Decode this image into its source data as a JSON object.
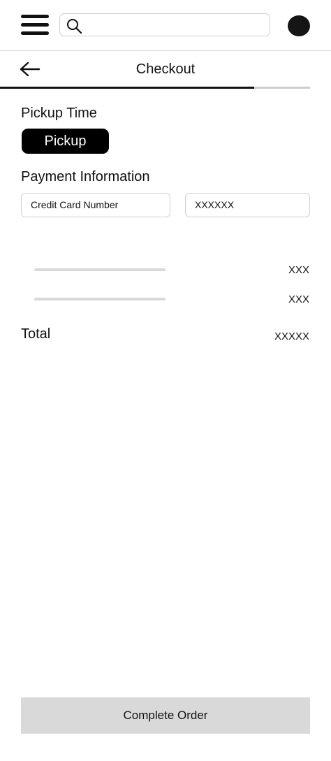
{
  "header": {
    "search_placeholder": ""
  },
  "subheader": {
    "title": "Checkout",
    "progress": 0.82
  },
  "pickup": {
    "section_label": "Pickup Time",
    "button_label": "Pickup"
  },
  "payment": {
    "section_label": "Payment Information",
    "card_number_label": "Credit Card Number",
    "card_number_value": "XXXXXX"
  },
  "summary": {
    "line_items": [
      {
        "amount": "XXX"
      },
      {
        "amount": "XXX"
      }
    ],
    "total_label": "Total",
    "total_value": "XXXXX"
  },
  "footer": {
    "complete_label": "Complete Order"
  },
  "icons": {
    "menu": "hamburger-menu-icon",
    "search": "search-icon",
    "back": "arrow-left-icon",
    "profile": "avatar"
  }
}
